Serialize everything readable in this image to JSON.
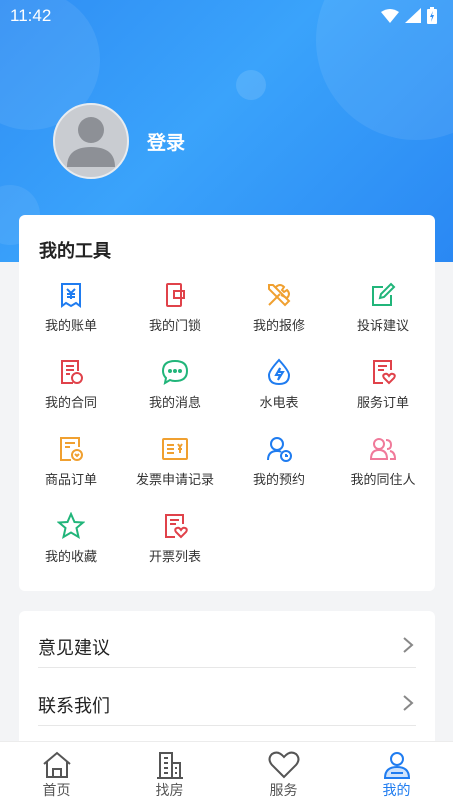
{
  "status_bar": {
    "time": "11:42"
  },
  "profile": {
    "login_label": "登录"
  },
  "tools": {
    "title": "我的工具",
    "items": [
      {
        "label": "我的账单",
        "icon": "bill-icon",
        "color": "#1f7cf0"
      },
      {
        "label": "我的门锁",
        "icon": "door-lock-icon",
        "color": "#e0424a"
      },
      {
        "label": "我的报修",
        "icon": "repair-tools-icon",
        "color": "#f0a030"
      },
      {
        "label": "投诉建议",
        "icon": "edit-note-icon",
        "color": "#21b57a"
      },
      {
        "label": "我的合同",
        "icon": "contract-icon",
        "color": "#e0424a"
      },
      {
        "label": "我的消息",
        "icon": "message-bubble-icon",
        "color": "#21b57a"
      },
      {
        "label": "水电表",
        "icon": "water-electric-icon",
        "color": "#1f7cf0"
      },
      {
        "label": "服务订单",
        "icon": "service-order-icon",
        "color": "#e0424a"
      },
      {
        "label": "商品订单",
        "icon": "product-order-icon",
        "color": "#f0a030"
      },
      {
        "label": "发票申请记录",
        "icon": "invoice-icon",
        "color": "#f0a030"
      },
      {
        "label": "我的预约",
        "icon": "appointment-icon",
        "color": "#1f7cf0"
      },
      {
        "label": "我的同住人",
        "icon": "roommates-icon",
        "color": "#f07a9a"
      },
      {
        "label": "我的收藏",
        "icon": "star-icon",
        "color": "#21b57a"
      },
      {
        "label": "开票列表",
        "icon": "invoice-list-icon",
        "color": "#e0424a"
      }
    ]
  },
  "menu": {
    "items": [
      {
        "label": "意见建议"
      },
      {
        "label": "联系我们"
      }
    ]
  },
  "tabbar": {
    "items": [
      {
        "label": "首页",
        "icon": "home-icon",
        "active": false
      },
      {
        "label": "找房",
        "icon": "building-icon",
        "active": false
      },
      {
        "label": "服务",
        "icon": "heart-icon",
        "active": false
      },
      {
        "label": "我的",
        "icon": "profile-icon",
        "active": true
      }
    ]
  },
  "colors": {
    "primary": "#1f7cf0",
    "hero": "#2f8ef4"
  }
}
